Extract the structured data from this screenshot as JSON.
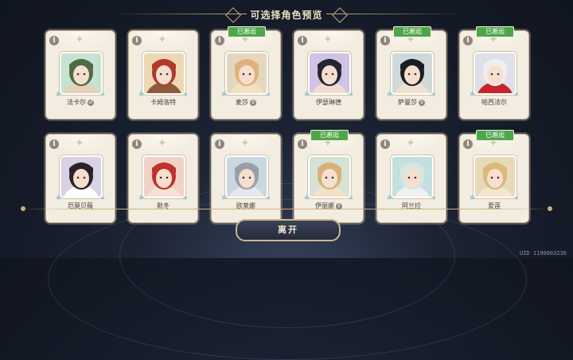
{
  "title": "可选择角色预览",
  "badge_label": "已邂逅",
  "characters": [
    {
      "name": "法卡尔",
      "met": false,
      "gender": "♂",
      "show_gender": true,
      "hair": "#4f6a44",
      "bg": "#c6e3d2",
      "accent": "#e3d2b8"
    },
    {
      "name": "卡姆洛特",
      "met": false,
      "gender": "",
      "show_gender": false,
      "hair": "#b23a2c",
      "bg": "#ecd9b4",
      "accent": "#8d5a3a"
    },
    {
      "name": "麦莎",
      "met": true,
      "gender": "♀",
      "show_gender": true,
      "hair": "#e0b27a",
      "bg": "#e4d7bf",
      "accent": "#f1e0c2"
    },
    {
      "name": "伊瑟琳德",
      "met": false,
      "gender": "",
      "show_gender": false,
      "hair": "#262431",
      "bg": "#d0c3e6",
      "accent": "#f2dcd2"
    },
    {
      "name": "萨曼莎",
      "met": true,
      "gender": "♀",
      "show_gender": true,
      "hair": "#1d1d25",
      "bg": "#cfd9d8",
      "accent": "#efe0d0"
    },
    {
      "name": "帕西法尔",
      "met": true,
      "gender": "",
      "show_gender": false,
      "hair": "#eeeeee",
      "bg": "#dfe0e8",
      "accent": "#c7232e"
    },
    {
      "name": "厄莫贝薇",
      "met": false,
      "gender": "",
      "show_gender": false,
      "hair": "#2b2229",
      "bg": "#d8d2e5",
      "accent": "#ffffff"
    },
    {
      "name": "默冬",
      "met": false,
      "gender": "",
      "show_gender": false,
      "hair": "#c2302c",
      "bg": "#f0d3c6",
      "accent": "#f8e1d7"
    },
    {
      "name": "欧莱娜",
      "met": false,
      "gender": "",
      "show_gender": false,
      "hair": "#9a9ea8",
      "bg": "#c9d7e2",
      "accent": "#e6e8ed"
    },
    {
      "name": "伊丽娜",
      "met": true,
      "gender": "♀",
      "show_gender": true,
      "hair": "#d6b278",
      "bg": "#d5e2d5",
      "accent": "#f2e2c8"
    },
    {
      "name": "阿兰拉",
      "met": false,
      "gender": "",
      "show_gender": false,
      "hair": "#d8e6e2",
      "bg": "#c3dfe0",
      "accent": "#f0f0ee"
    },
    {
      "name": "爱莲",
      "met": true,
      "gender": "",
      "show_gender": false,
      "hair": "#d9ba7a",
      "bg": "#e8d9b9",
      "accent": "#f4e6cf"
    }
  ],
  "leave_button": "离开",
  "uid": "UID 1190003236"
}
